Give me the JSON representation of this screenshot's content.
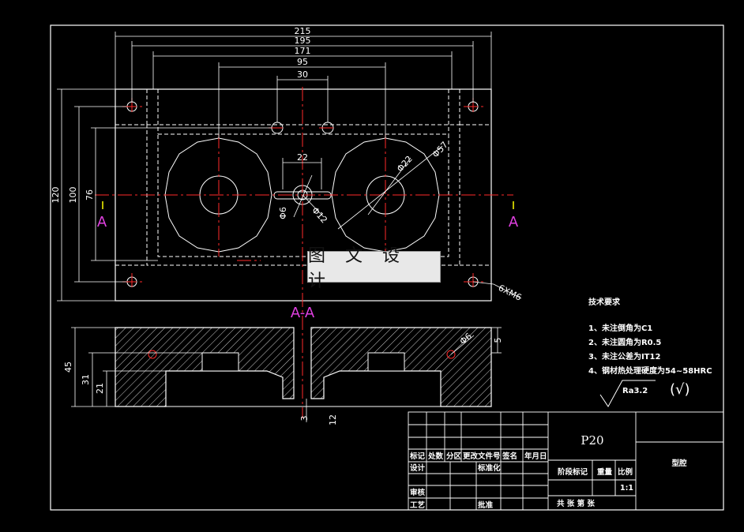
{
  "watermark": "图 文 设 计",
  "dimensions": {
    "w215": "215",
    "w195": "195",
    "w171": "171",
    "w95": "95",
    "w30": "30",
    "w22": "22",
    "h120": "120",
    "h100": "100",
    "h76": "76",
    "phi6": "Φ6",
    "phi12": "Φ12",
    "phi22": "Φ22",
    "phi57": "Φ57",
    "thread": "6XM6",
    "h45": "45",
    "h31": "31",
    "h21": "21",
    "d3": "3",
    "d12": "12",
    "d5": "5",
    "phi6b": "Φ6"
  },
  "section": {
    "label_left": "A",
    "label_right": "A",
    "view_title": "A-A"
  },
  "notes": {
    "title": "技术要求",
    "items": [
      "1、未注倒角为C1",
      "2、未注圆角为R0.5",
      "3、未注公差为IT12",
      "4、钢材热处理硬度为54~58HRC"
    ]
  },
  "roughness": {
    "value": "Ra3.2",
    "mark": "(√)"
  },
  "title_block": {
    "material": "P20",
    "part_name": "型腔",
    "scale": "1:1",
    "header_cells": [
      "标记",
      "处数",
      "分区",
      "更改文件号",
      "签名",
      "年月日"
    ],
    "row_design": "设计",
    "row_standard": "标准化",
    "row_review": "审核",
    "row_process": "工艺",
    "row_approve": "批准",
    "stage_mark": "阶段标记",
    "weight": "重量",
    "scale_label": "比例",
    "sheets": "共 张 第 张"
  },
  "colors": {
    "outline": "#ffffff",
    "center_line": "#ff2a2a",
    "hidden": "#ffffff",
    "section_label": "#e040e0",
    "watermark_bg": "#e8e8e8"
  }
}
